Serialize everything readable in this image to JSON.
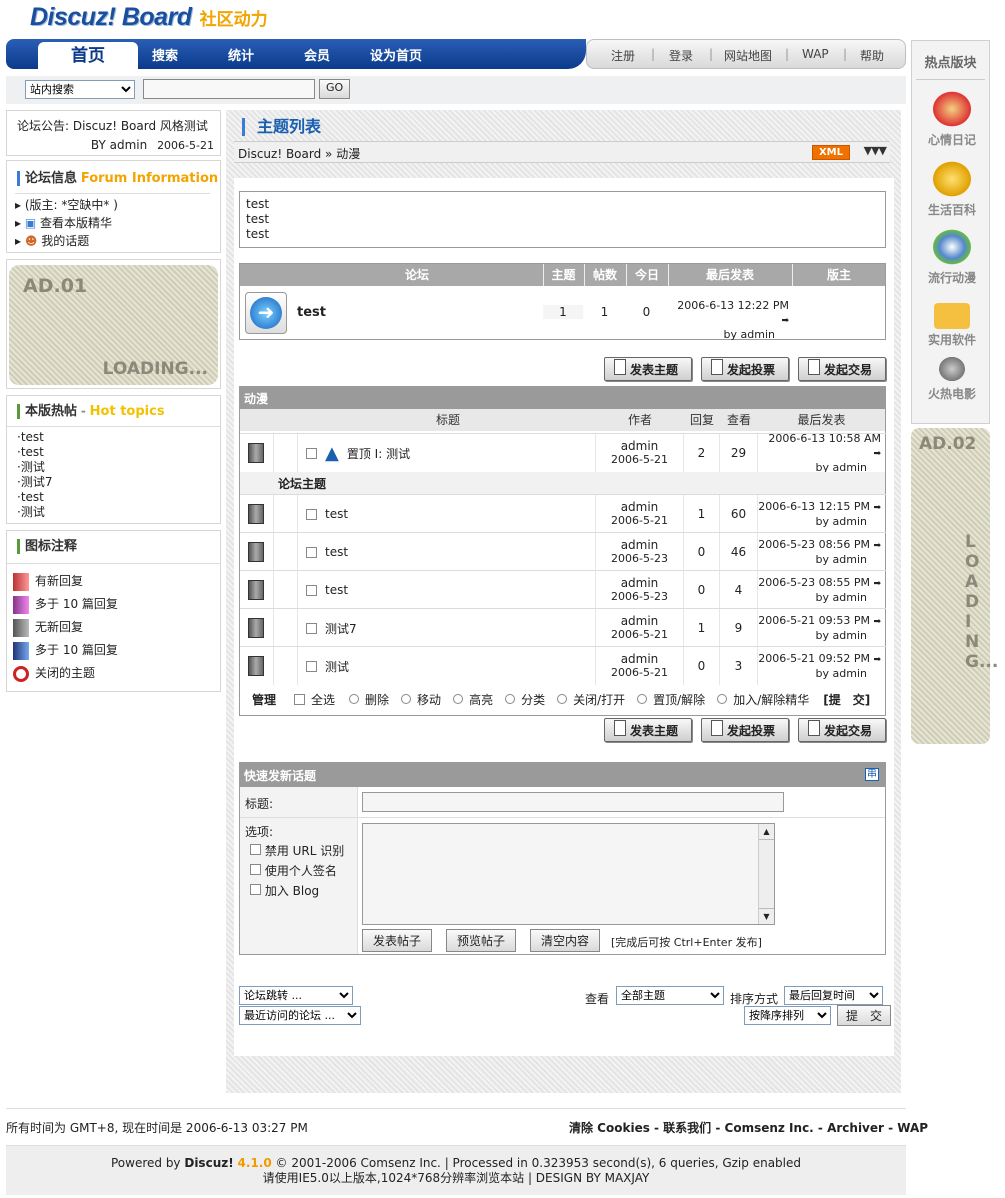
{
  "logo": {
    "text1": "Discuz! Board",
    "text2": "社区动力"
  },
  "nav": {
    "home": "首页",
    "items": [
      "搜索",
      "统计",
      "会员",
      "设为首页"
    ],
    "right": [
      "注册",
      "登录",
      "网站地图",
      "WAP",
      "帮助"
    ]
  },
  "search": {
    "scope": "站内搜索",
    "go": "GO"
  },
  "announce": {
    "prefix": "论坛公告: ",
    "title": "Discuz! Board 风格测试",
    "by": "BY admin",
    "date": "2006-5-21"
  },
  "info": {
    "title": "论坛信息",
    "title_en": "Forum Information",
    "moderator": "(版主: *空缺中* )",
    "digest": "查看本版精华",
    "mytopics": "我的话题"
  },
  "ad1": {
    "label": "AD.01",
    "loading": "LOADING..."
  },
  "hot": {
    "title": "本版热帖",
    "title_en": "Hot topics",
    "items": [
      "test",
      "test",
      "测试",
      "测试7",
      "test",
      "测试"
    ]
  },
  "legend": {
    "title": "图标注释",
    "items": [
      "有新回复",
      "多于 10 篇回复",
      "无新回复",
      "多于 10 篇回复",
      "关闭的主题"
    ]
  },
  "main": {
    "title": "主题列表",
    "crumb_site": "Discuz! Board",
    "crumb_forum": "动漫",
    "xml": "XML",
    "rules": [
      "test",
      "test",
      "test"
    ]
  },
  "subforum": {
    "headers": [
      "论坛",
      "主题",
      "帖数",
      "今日",
      "最后发表",
      "版主"
    ],
    "name": "test",
    "topics": "1",
    "posts": "1",
    "today": "0",
    "last_time": "2006-6-13 12:22 PM",
    "last_by": "by admin"
  },
  "buttons": {
    "newtopic": "发表主题",
    "poll": "发起投票",
    "trade": "发起交易"
  },
  "threads": {
    "forum": "动漫",
    "headers": [
      "标题",
      "作者",
      "回复",
      "查看",
      "最后发表"
    ],
    "sticky_label": "置顶 I:",
    "sticky": {
      "title": "测试",
      "author": "admin",
      "date": "2006-5-21",
      "replies": "2",
      "views": "29",
      "last_time": "2006-6-13 10:58 AM",
      "last_by": "by admin"
    },
    "section": "论坛主题",
    "rows": [
      {
        "title": "test",
        "author": "admin",
        "date": "2006-5-21",
        "replies": "1",
        "views": "60",
        "last_time": "2006-6-13 12:15 PM",
        "last_by": "by admin"
      },
      {
        "title": "test",
        "author": "admin",
        "date": "2006-5-23",
        "replies": "0",
        "views": "46",
        "last_time": "2006-5-23 08:56 PM",
        "last_by": "by admin"
      },
      {
        "title": "test",
        "author": "admin",
        "date": "2006-5-23",
        "replies": "0",
        "views": "4",
        "last_time": "2006-5-23 08:55 PM",
        "last_by": "by admin"
      },
      {
        "title": "测试7",
        "author": "admin",
        "date": "2006-5-21",
        "replies": "1",
        "views": "9",
        "last_time": "2006-5-21 09:53 PM",
        "last_by": "by admin"
      },
      {
        "title": "测试",
        "author": "admin",
        "date": "2006-5-21",
        "replies": "0",
        "views": "3",
        "last_time": "2006-5-21 09:52 PM",
        "last_by": "by admin"
      }
    ]
  },
  "manage": {
    "label": "管理",
    "selectall": "全选",
    "ops": [
      "删除",
      "移动",
      "高亮",
      "分类",
      "关闭/打开",
      "置顶/解除",
      "加入/解除精华"
    ],
    "submit": "[提　交]"
  },
  "quick": {
    "title": "快速发新话题",
    "subject": "标题:",
    "options": "选项:",
    "opt1": "禁用 URL 识别",
    "opt2": "使用个人签名",
    "opt3": "加入 Blog",
    "post": "发表帖子",
    "preview": "预览帖子",
    "clear": "清空内容",
    "hint": "[完成后可按 Ctrl+Enter 发布]",
    "toggle": "串"
  },
  "bottom": {
    "jump": "论坛跳转 ...",
    "recent": "最近访问的论坛 ...",
    "view": "查看",
    "view_sel": "全部主题",
    "order": "排序方式",
    "order_sel": "最后回复时间",
    "dir_sel": "按降序排列",
    "submit": "提　交"
  },
  "footer": {
    "time": "所有时间为 GMT+8, 现在时间是 2006-6-13 03:27 PM",
    "links": "清除 Cookies - 联系我们 - Comsenz Inc. - Archiver - WAP",
    "powered": "Powered by ",
    "product": "Discuz!",
    "version": "4.1.0",
    "rest": " © 2001-2006 Comsenz Inc. | Processed in 0.323953 second(s), 6 queries, Gzip enabled",
    "line2": "请使用IE5.0以上版本,1024*768分辨率浏览本站 | DESIGN BY MAXJAY"
  },
  "right": {
    "title": "热点版块",
    "items": [
      "心情日记",
      "生活百科",
      "流行动漫",
      "实用软件",
      "火热电影"
    ],
    "ad2": "AD.02",
    "loading": "LOADING..."
  }
}
